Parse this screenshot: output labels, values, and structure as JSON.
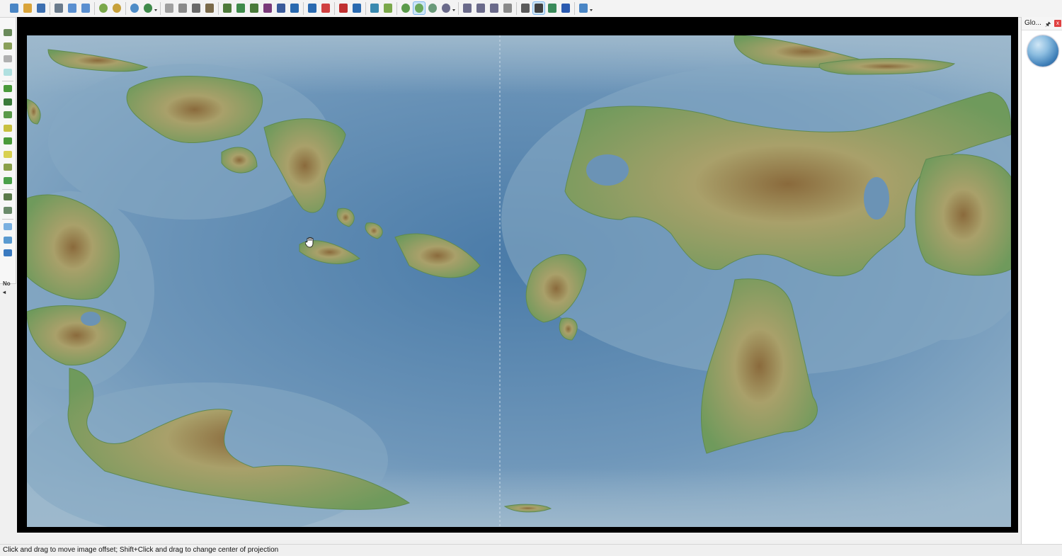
{
  "toolbar": {
    "groups": [
      {
        "items": [
          "new-file-icon",
          "open-folder-icon",
          "save-icon"
        ]
      },
      {
        "items": [
          "print-icon",
          "undo-icon",
          "redo-icon"
        ]
      },
      {
        "items": [
          "sphere-icon",
          "color-sphere-icon"
        ]
      },
      {
        "items": [
          "globe-icon",
          "globe-dropdown-icon"
        ]
      },
      {
        "items": [
          "rect-select-icon",
          "ellipse-select-icon",
          "lasso-select-icon",
          "poly-select-icon"
        ]
      },
      {
        "items": [
          "terrain-raise-icon",
          "terrain-lower-icon",
          "terrain-smooth-icon",
          "terrain-peak-icon",
          "terrain-mountain-icon",
          "terrain-flat-icon"
        ]
      },
      {
        "items": [
          "river-icon",
          "river-alt-icon"
        ]
      },
      {
        "items": [
          "temperature-icon",
          "temperature-alt-icon"
        ]
      },
      {
        "items": [
          "sea-level-icon",
          "layers-icon"
        ]
      },
      {
        "items": [
          "view-globe-icon",
          "view-globe-active-icon",
          "view-globe-alt-icon",
          "view-globe-dropdown-icon"
        ]
      },
      {
        "items": [
          "zoom-in-icon",
          "zoom-out-icon",
          "zoom-fit-icon",
          "zoom-rect-icon"
        ]
      },
      {
        "items": [
          "measure-icon",
          "pan-hand-icon",
          "grid-icon",
          "overlay-icon"
        ]
      },
      {
        "items": [
          "info-icon"
        ]
      }
    ]
  },
  "left_tools": {
    "items": [
      "brush-raise-icon",
      "brush-lower-icon",
      "brush-flat-icon",
      "brush-noise-icon",
      "vegetation-icon",
      "forest-icon",
      "biome-a-icon",
      "biome-b-icon",
      "biome-c-icon",
      "biome-d-icon",
      "biome-e-icon",
      "biome-f-icon",
      "grass-icon",
      "tundra-icon",
      "water-shallow-icon",
      "water-mid-icon",
      "water-deep-icon"
    ],
    "no_label": "No"
  },
  "panel": {
    "title": "Glo...",
    "pin": "🖈",
    "close": "x"
  },
  "status": {
    "text": "Click and drag to move image offset; Shift+Click and drag to change center of projection"
  },
  "colors": {
    "ocean_deep": "#4a7ba8",
    "ocean_shallow": "#8fb0c6",
    "land_low": "#6f9a5c",
    "land_mid": "#a9a06a",
    "land_high": "#8a6a3c"
  }
}
